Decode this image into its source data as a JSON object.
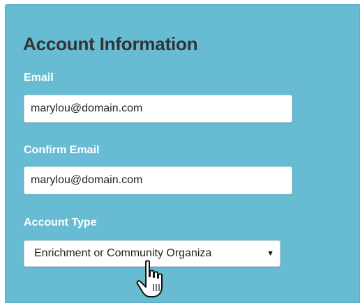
{
  "form": {
    "title": "Account Information",
    "email_label": "Email",
    "email_value": "marylou@domain.com",
    "confirm_email_label": "Confirm Email",
    "confirm_email_value": "marylou@domain.com",
    "account_type_label": "Account Type",
    "account_type_value": "Enrichment or Community Organiza",
    "dropdown_caret": "▼"
  },
  "colors": {
    "panel_background": "#67bcd3",
    "title_text": "#333333",
    "label_text": "#ffffff",
    "input_background": "#ffffff"
  },
  "icons": {
    "cursor": "hand-pointer-icon",
    "dropdown": "caret-down-icon"
  }
}
